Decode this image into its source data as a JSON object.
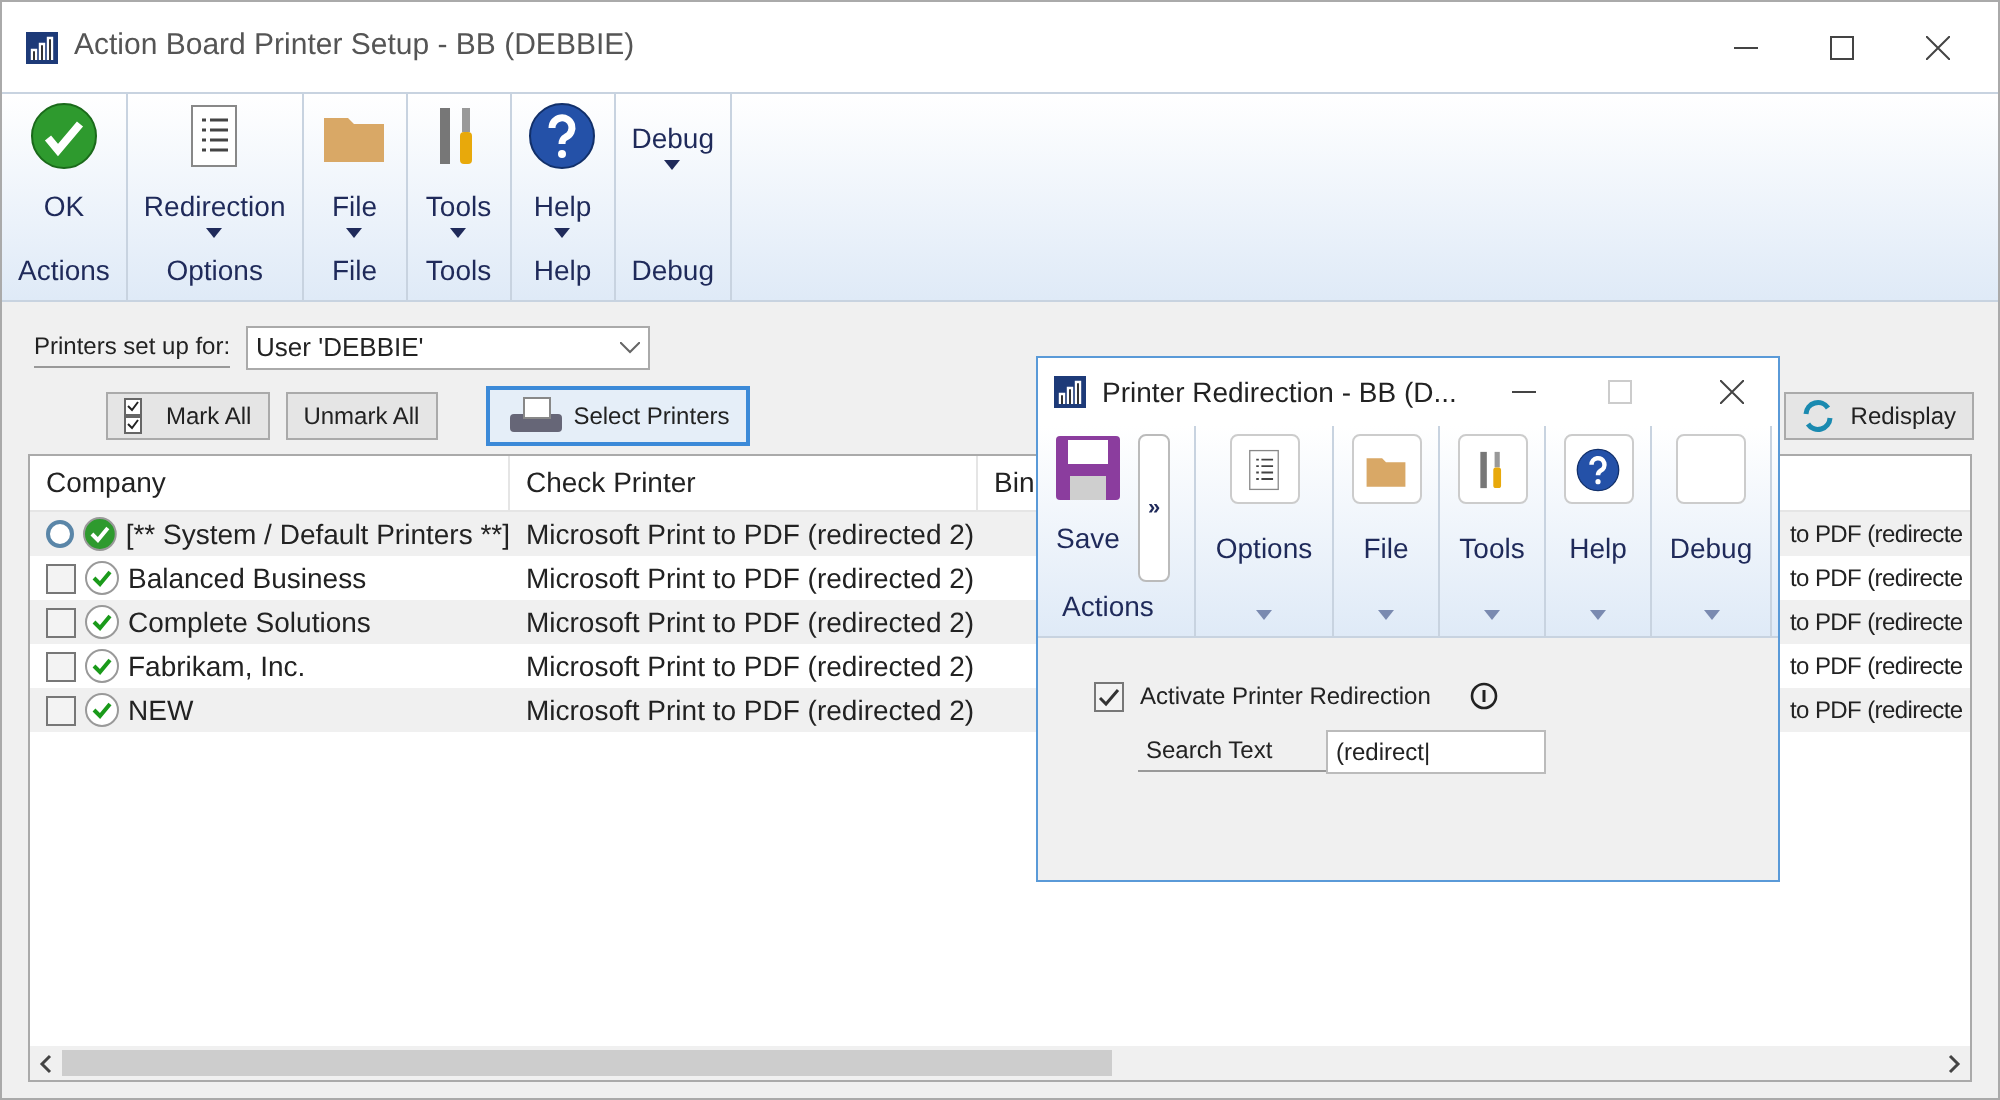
{
  "window": {
    "title": "Action Board Printer Setup  -  BB (DEBBIE)"
  },
  "ribbon": {
    "groups": [
      {
        "label": "Actions",
        "button": {
          "label": "OK",
          "has_menu": false
        }
      },
      {
        "label": "Options",
        "button": {
          "label": "Redirection",
          "has_menu": true
        }
      },
      {
        "label": "File",
        "button": {
          "label": "File",
          "has_menu": true
        }
      },
      {
        "label": "Tools",
        "button": {
          "label": "Tools",
          "has_menu": true
        }
      },
      {
        "label": "Help",
        "button": {
          "label": "Help",
          "has_menu": true
        }
      },
      {
        "label": "Debug",
        "button": {
          "label": "Debug",
          "has_menu": true
        }
      }
    ]
  },
  "printers_for": {
    "label": "Printers set up for:",
    "value": "User 'DEBBIE'"
  },
  "toolbar": {
    "mark_all": "Mark All",
    "unmark_all": "Unmark All",
    "select_printers": "Select Printers",
    "redisplay": "Redisplay"
  },
  "table": {
    "columns": [
      "Company",
      "Check Printer",
      "Bin"
    ],
    "rows": [
      {
        "kind": "default",
        "checked": false,
        "company": "[** System / Default Printers **]",
        "check_printer": "Microsoft Print to PDF (redirected 2)",
        "column_4": "to PDF (redirecte"
      },
      {
        "kind": "company",
        "checked": false,
        "company": "Balanced Business",
        "check_printer": "Microsoft Print to PDF (redirected 2)",
        "column_4": "to PDF (redirecte"
      },
      {
        "kind": "company",
        "checked": false,
        "company": "Complete Solutions",
        "check_printer": "Microsoft Print to PDF (redirected 2)",
        "column_4": "to PDF (redirecte"
      },
      {
        "kind": "company",
        "checked": false,
        "company": "Fabrikam, Inc.",
        "check_printer": "Microsoft Print to PDF (redirected 2)",
        "column_4": "to PDF (redirecte"
      },
      {
        "kind": "company",
        "checked": false,
        "company": "NEW",
        "check_printer": "Microsoft Print to PDF (redirected 2)",
        "column_4": "to PDF (redirecte"
      }
    ]
  },
  "dialog": {
    "title": "Printer Redirection  -  BB (D...",
    "save": "Save",
    "overflow": "»",
    "actions_label": "Actions",
    "buttons": [
      {
        "label": "Options",
        "has_menu": true
      },
      {
        "label": "File",
        "has_menu": true
      },
      {
        "label": "Tools",
        "has_menu": true
      },
      {
        "label": "Help",
        "has_menu": true
      },
      {
        "label": "Debug",
        "has_menu": true
      }
    ],
    "activate": {
      "label": "Activate Printer Redirection",
      "checked": true
    },
    "search": {
      "label": "Search Text",
      "value": "(redirect|"
    }
  }
}
